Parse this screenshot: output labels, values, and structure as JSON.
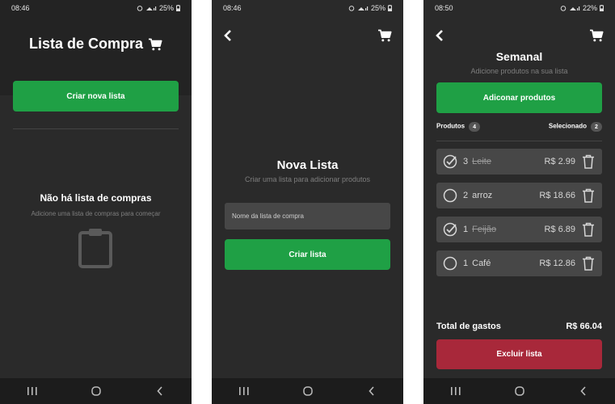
{
  "colors": {
    "background": "#2a2a2a",
    "primary_button": "#1fa045",
    "danger_button": "#a8283a",
    "card": "#474747",
    "muted_text": "#7e7e7e"
  },
  "screens": [
    {
      "status": {
        "time": "08:46",
        "battery": "25%"
      },
      "title": "Lista de Compra",
      "title_icon": "cart-icon",
      "create_button": "Criar nova lista",
      "empty_title": "Não há lista de compras",
      "empty_subtitle": "Adicione uma lista de compras para começar",
      "empty_icon": "clipboard-icon"
    },
    {
      "status": {
        "time": "08:46",
        "battery": "25%"
      },
      "back_icon": "back-chevron-icon",
      "cart_icon": "cart-icon",
      "title": "Nova Lista",
      "subtitle": "Criar uma lista para adicionar produtos",
      "input_placeholder": "Nome da lista de compra",
      "create_button": "Criar lista"
    },
    {
      "status": {
        "time": "08:50",
        "battery": "22%"
      },
      "back_icon": "back-chevron-icon",
      "cart_icon": "cart-icon",
      "title": "Semanal",
      "subtitle": "Adicione produtos na sua lista",
      "add_button": "Adiconar produtos",
      "products_label": "Produtos",
      "products_count": "4",
      "selected_label": "Selecionado",
      "selected_count": "2",
      "items": [
        {
          "qty": "3",
          "name": "Leite",
          "price": "R$ 2.99",
          "checked": true
        },
        {
          "qty": "2",
          "name": "arroz",
          "price": "R$ 18.66",
          "checked": false
        },
        {
          "qty": "1",
          "name": "Feijão",
          "price": "R$ 6.89",
          "checked": true
        },
        {
          "qty": "1",
          "name": "Café",
          "price": "R$ 12.86",
          "checked": false
        }
      ],
      "total_label": "Total de gastos",
      "total_value": "R$ 66.04",
      "delete_button": "Excluir lista"
    }
  ],
  "nav_icons": [
    "recent-apps-icon",
    "home-icon",
    "back-icon"
  ]
}
